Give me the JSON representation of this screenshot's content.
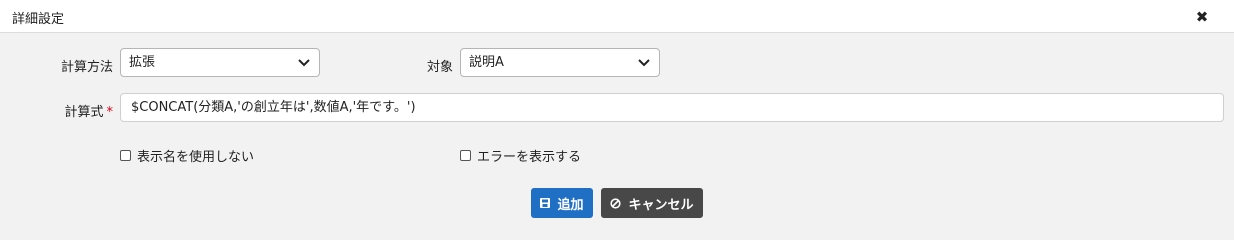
{
  "dialog": {
    "title": "詳細設定"
  },
  "form": {
    "calc_method_label": "計算方法",
    "calc_method_value": "拡張",
    "target_label": "対象",
    "target_value": "説明A",
    "formula_label": "計算式",
    "required_mark": "*",
    "formula_value": "$CONCAT(分類A,'の創立年は',数値A,'年です。')",
    "no_display_name_label": "表示名を使用しない",
    "show_errors_label": "エラーを表示する"
  },
  "actions": {
    "add_label": "追加",
    "cancel_label": "キャンセル"
  },
  "colors": {
    "primary": "#1f6fc5",
    "secondary": "#484848",
    "required": "#d0021b"
  }
}
